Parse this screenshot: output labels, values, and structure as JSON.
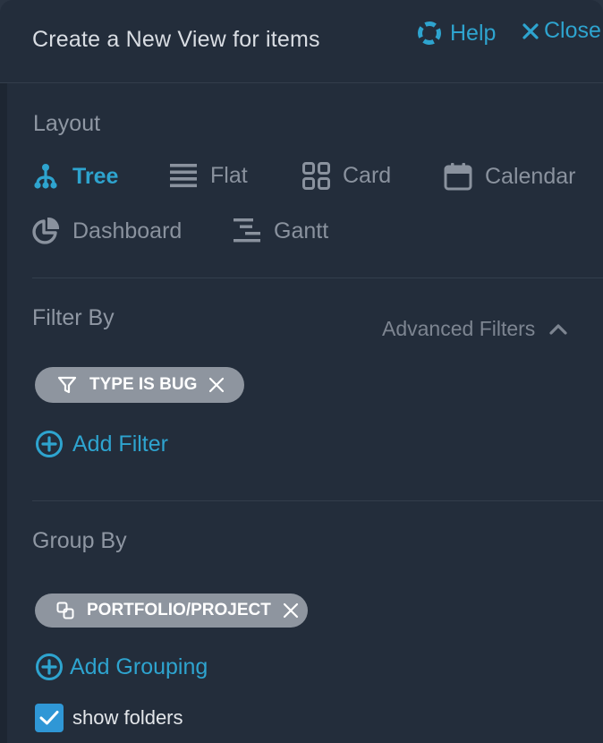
{
  "header": {
    "title": "Create a New View for items",
    "help_label": "Help",
    "close_label": "Close"
  },
  "layout": {
    "label": "Layout",
    "options": [
      {
        "label": "Tree",
        "icon": "tree-icon",
        "active": true
      },
      {
        "label": "Flat",
        "icon": "list-icon",
        "active": false
      },
      {
        "label": "Card",
        "icon": "grid-icon",
        "active": false
      },
      {
        "label": "Calendar",
        "icon": "calendar-icon",
        "active": false
      },
      {
        "label": "Dashboard",
        "icon": "pie-chart-icon",
        "active": false
      },
      {
        "label": "Gantt",
        "icon": "gantt-icon",
        "active": false
      }
    ]
  },
  "filter": {
    "label": "Filter By",
    "advanced_label": "Advanced Filters",
    "chip_label": "TYPE IS BUG",
    "add_label": "Add Filter"
  },
  "group": {
    "label": "Group By",
    "chip_label": "PORTFOLIO/PROJECT",
    "add_label": "Add Grouping"
  },
  "options": {
    "show_folders_label": "show folders",
    "show_folders_checked": true
  },
  "colors": {
    "accent": "#2ea4cf",
    "panel": "#232d3b",
    "chip": "#8e959f",
    "checkbox": "#2f97d6"
  }
}
